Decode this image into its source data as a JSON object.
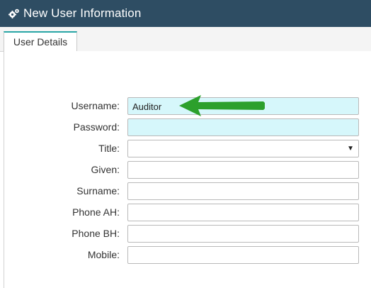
{
  "window": {
    "title": "New User Information",
    "icon": "gears-icon"
  },
  "tabs": [
    {
      "label": "User Details",
      "active": true
    }
  ],
  "form": {
    "fields": [
      {
        "label": "Username:",
        "value": "Auditor",
        "type": "text",
        "highlighted": true
      },
      {
        "label": "Password:",
        "value": "",
        "type": "password",
        "highlighted": true
      },
      {
        "label": "Title:",
        "value": "",
        "type": "select",
        "highlighted": false
      },
      {
        "label": "Given:",
        "value": "",
        "type": "text",
        "highlighted": false
      },
      {
        "label": "Surname:",
        "value": "",
        "type": "text",
        "highlighted": false
      },
      {
        "label": "Phone AH:",
        "value": "",
        "type": "text",
        "highlighted": false
      },
      {
        "label": "Phone BH:",
        "value": "",
        "type": "text",
        "highlighted": false
      },
      {
        "label": "Mobile:",
        "value": "",
        "type": "text",
        "highlighted": false
      }
    ]
  },
  "colors": {
    "titlebar": "#2e4d63",
    "tab_accent": "#29a6a6",
    "highlight_field": "#d6f7fb",
    "annotation_arrow": "#2ca02c"
  }
}
